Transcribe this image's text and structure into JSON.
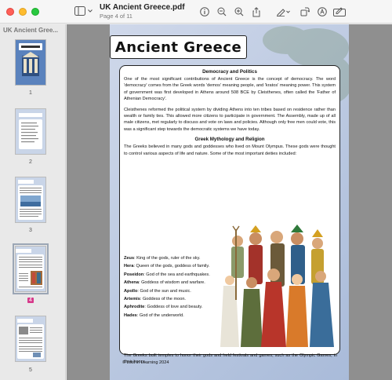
{
  "window": {
    "title": "UK Ancient Greece.pdf",
    "subtitle": "Page 4 of 11"
  },
  "toolbar": {
    "icons": [
      "info-icon",
      "zoom-out-icon",
      "zoom-in-icon",
      "share-icon",
      "markup-pen-icon",
      "rotate-icon",
      "annotate-icon",
      "form-fill-icon"
    ]
  },
  "sidebar": {
    "title": "UK Ancient Gree...",
    "pages": [
      {
        "num": "1"
      },
      {
        "num": "2"
      },
      {
        "num": "3"
      },
      {
        "num": "4",
        "active": true
      },
      {
        "num": "5"
      }
    ]
  },
  "page": {
    "banner": "Ancient Greece",
    "section1_title": "Democracy and Politics",
    "p1": "One of the most significant contributions of Ancient Greece is the concept of democracy. The word 'democracy' comes from the Greek words 'demos' meaning people, and 'kratos' meaning power. This system of government was first developed in Athens around 508 BCE by Cleisthenes, often called the 'Father of Athenian Democracy'.",
    "p2": "Cleisthenes reformed the political system by dividing Athens into ten tribes based on residence rather than wealth or family ties. This allowed more citizens to participate in government. The Assembly, made up of all male citizens, met regularly to discuss and vote on laws and policies. Although only free men could vote, this was a significant step towards the democratic systems we have today.",
    "section2_title": "Greek Mythology and Religion",
    "p3": "The Greeks believed in many gods and goddesses who lived on Mount Olympus. These gods were thought to control various aspects of life and nature. Some of the most important deities included:",
    "deities": [
      {
        "name": "Zeus",
        "desc": ": King of the gods, ruler of the sky."
      },
      {
        "name": "Hera",
        "desc": ": Queen of the gods, goddess of family."
      },
      {
        "name": "Poseidon",
        "desc": ": God of the sea and earthquakes."
      },
      {
        "name": "Athena",
        "desc": ": Goddess of wisdom and warfare."
      },
      {
        "name": "Apollo",
        "desc": ": God of the sun and music."
      },
      {
        "name": "Artemis",
        "desc": ": Goddess of the moon."
      },
      {
        "name": "Aphrodite",
        "desc": ": Goddess of love and beauty."
      },
      {
        "name": "Hades",
        "desc": ": God of the underworld."
      }
    ],
    "closing": "The Greeks built temples to honor their gods and held festivals and games, such as the Olympic Games, in their honor.",
    "footer": "© Lost in Learning 2024"
  },
  "colors": {
    "accent_badge": "#d63a8b",
    "page_bg": "#b8c7e0",
    "viewer_bg": "#8f8f8f"
  }
}
